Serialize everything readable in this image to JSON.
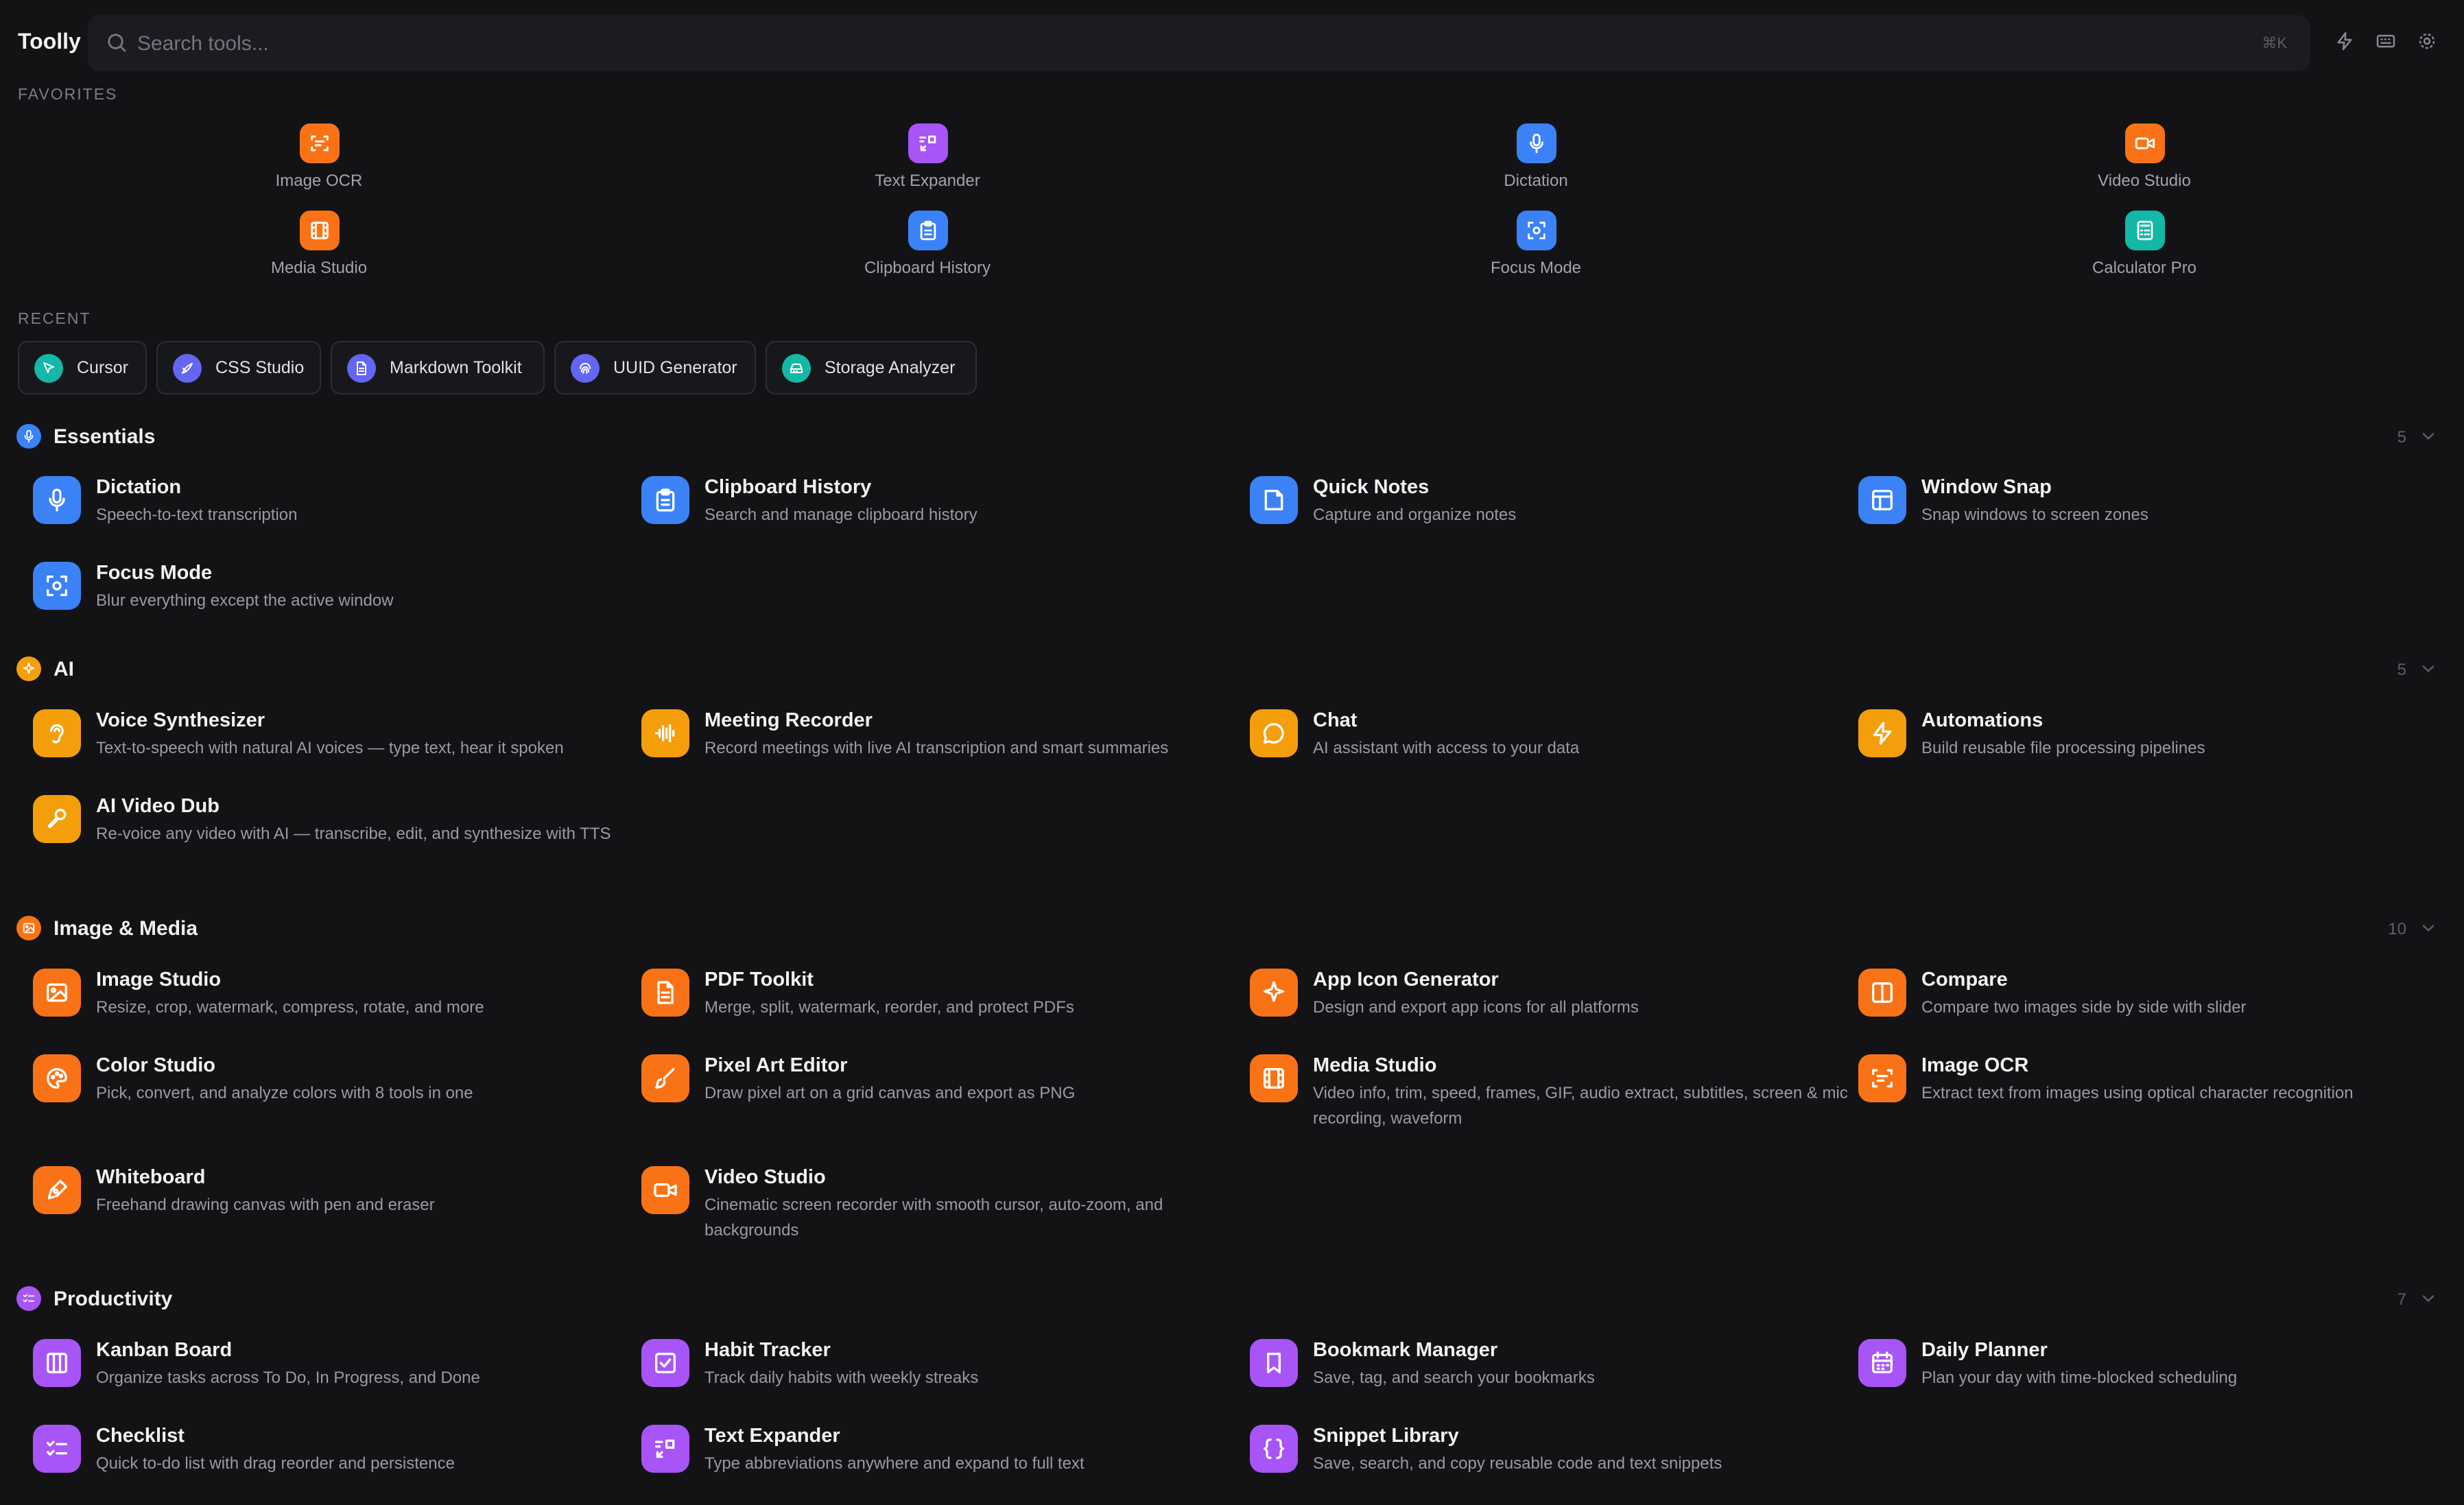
{
  "app": {
    "title": "Toolly"
  },
  "search": {
    "placeholder": "Search tools...",
    "shortcut": "⌘K"
  },
  "colors": {
    "background": "#131316",
    "orange": "#f97316",
    "amber": "#f59e0b",
    "purple": "#a855f7",
    "blue": "#3b82f6",
    "teal": "#14b8a6",
    "indigo": "#6366f1"
  },
  "favorites": {
    "label": "FAVORITES",
    "items": [
      {
        "label": "Image OCR",
        "icon": "scan-text-icon"
      },
      {
        "label": "Text Expander",
        "icon": "text-expand-icon"
      },
      {
        "label": "Dictation",
        "icon": "microphone-icon"
      },
      {
        "label": "Video Studio",
        "icon": "video-camera-icon"
      },
      {
        "label": "Media Studio",
        "icon": "film-icon"
      },
      {
        "label": "Clipboard History",
        "icon": "clipboard-icon"
      },
      {
        "label": "Focus Mode",
        "icon": "focus-icon"
      },
      {
        "label": "Calculator Pro",
        "icon": "calculator-icon"
      }
    ]
  },
  "recent": {
    "label": "RECENT",
    "items": [
      {
        "label": "Cursor",
        "icon": "cursor-icon"
      },
      {
        "label": "CSS Studio",
        "icon": "css-icon"
      },
      {
        "label": "Markdown Toolkit",
        "icon": "document-icon"
      },
      {
        "label": "UUID Generator",
        "icon": "fingerprint-icon"
      },
      {
        "label": "Storage Analyzer",
        "icon": "hard-drive-icon"
      }
    ]
  },
  "categories": [
    {
      "title": "Essentials",
      "count": "5",
      "icon": "microphone-icon",
      "tools": [
        {
          "name": "Dictation",
          "desc": "Speech-to-text transcription",
          "icon": "microphone-icon"
        },
        {
          "name": "Clipboard History",
          "desc": "Search and manage clipboard history",
          "icon": "clipboard-icon"
        },
        {
          "name": "Quick Notes",
          "desc": "Capture and organize notes",
          "icon": "note-icon"
        },
        {
          "name": "Window Snap",
          "desc": "Snap windows to screen zones",
          "icon": "layout-icon"
        },
        {
          "name": "Focus Mode",
          "desc": "Blur everything except the active window",
          "icon": "focus-icon"
        }
      ]
    },
    {
      "title": "AI",
      "count": "5",
      "icon": "sparkles-icon",
      "tools": [
        {
          "name": "Voice Synthesizer",
          "desc": "Text-to-speech with natural AI voices — type text, hear it spoken",
          "icon": "ear-icon"
        },
        {
          "name": "Meeting Recorder",
          "desc": "Record meetings with live AI transcription and smart summaries",
          "icon": "audio-waveform-icon"
        },
        {
          "name": "Chat",
          "desc": "AI assistant with access to your data",
          "icon": "chat-bubble-icon"
        },
        {
          "name": "Automations",
          "desc": "Build reusable file processing pipelines",
          "icon": "lightning-icon"
        },
        {
          "name": "AI Video Dub",
          "desc": "Re-voice any video with AI — transcribe, edit, and synthesize with TTS",
          "icon": "mic-pen-icon"
        }
      ]
    },
    {
      "title": "Image & Media",
      "count": "10",
      "icon": "image-icon",
      "tools": [
        {
          "name": "Image Studio",
          "desc": "Resize, crop, watermark, compress, rotate, and more",
          "icon": "image-icon"
        },
        {
          "name": "PDF Toolkit",
          "desc": "Merge, split, watermark, reorder, and protect PDFs",
          "icon": "document-icon"
        },
        {
          "name": "App Icon Generator",
          "desc": "Design and export app icons for all platforms",
          "icon": "sparkles-icon"
        },
        {
          "name": "Compare",
          "desc": "Compare two images side by side with slider",
          "icon": "split-view-icon"
        },
        {
          "name": "Color Studio",
          "desc": "Pick, convert, and analyze colors with 8 tools in one",
          "icon": "palette-icon"
        },
        {
          "name": "Pixel Art Editor",
          "desc": "Draw pixel art on a grid canvas and export as PNG",
          "icon": "brush-icon"
        },
        {
          "name": "Media Studio",
          "desc": "Video info, trim, speed, frames, GIF, audio extract, subtitles, screen & mic recording, waveform",
          "icon": "film-icon"
        },
        {
          "name": "Image OCR",
          "desc": "Extract text from images using optical character recognition",
          "icon": "scan-text-icon"
        },
        {
          "name": "Whiteboard",
          "desc": "Freehand drawing canvas with pen and eraser",
          "icon": "pen-tool-icon"
        },
        {
          "name": "Video Studio",
          "desc": "Cinematic screen recorder with smooth cursor, auto-zoom, and backgrounds",
          "icon": "video-camera-icon"
        }
      ]
    },
    {
      "title": "Productivity",
      "count": "7",
      "icon": "list-check-icon",
      "tools": [
        {
          "name": "Kanban Board",
          "desc": "Organize tasks across To Do, In Progress, and Done",
          "icon": "columns-icon"
        },
        {
          "name": "Habit Tracker",
          "desc": "Track daily habits with weekly streaks",
          "icon": "check-square-icon"
        },
        {
          "name": "Bookmark Manager",
          "desc": "Save, tag, and search your bookmarks",
          "icon": "bookmark-icon"
        },
        {
          "name": "Daily Planner",
          "desc": "Plan your day with time-blocked scheduling",
          "icon": "calendar-icon"
        },
        {
          "name": "Checklist",
          "desc": "Quick to-do list with drag reorder and persistence",
          "icon": "list-check-icon"
        },
        {
          "name": "Text Expander",
          "desc": "Type abbreviations anywhere and expand to full text",
          "icon": "text-expand-icon"
        },
        {
          "name": "Snippet Library",
          "desc": "Save, search, and copy reusable code and text snippets",
          "icon": "braces-icon"
        }
      ]
    }
  ]
}
